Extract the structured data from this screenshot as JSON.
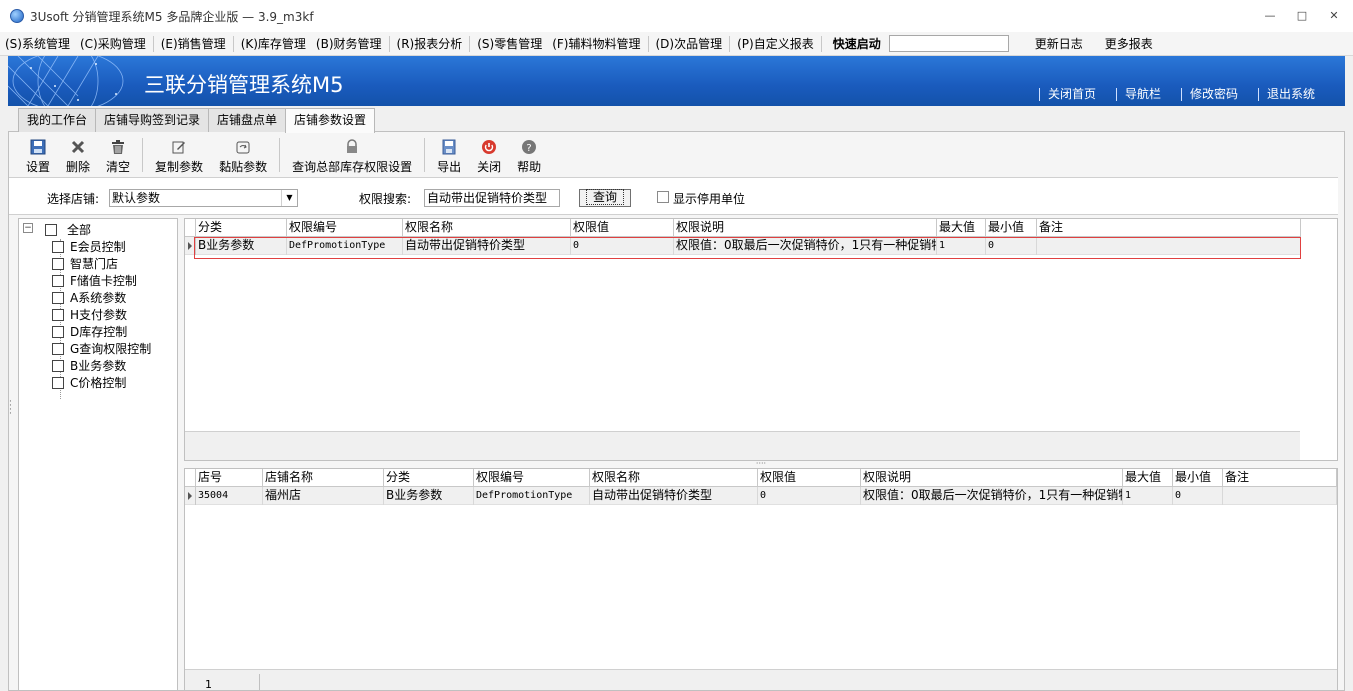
{
  "window": {
    "title": "3Usoft 分销管理系统M5 多品牌企业版 — 3.9_m3kf",
    "controls": [
      "minimize-icon",
      "restore-icon",
      "close-icon"
    ]
  },
  "menubar": {
    "items": [
      "(S)系统管理",
      "(C)采购管理",
      "(E)销售管理",
      "(K)库存管理",
      "(B)财务管理",
      "(R)报表分析",
      "(S)零售管理",
      "(F)辅料物料管理",
      "(D)次品管理",
      "(P)自定义报表"
    ],
    "quick_label": "快速启动",
    "quick_value": "",
    "right": [
      "更新日志",
      "更多报表"
    ]
  },
  "banner": {
    "brand": "三联分销管理系统M5",
    "links": [
      "关闭首页",
      "导航栏",
      "修改密码",
      "退出系统"
    ],
    "color": "#1a5bbd"
  },
  "tabs": [
    {
      "label": "我的工作台"
    },
    {
      "label": "店铺导购签到记录"
    },
    {
      "label": "店铺盘点单"
    },
    {
      "label": "店铺参数设置",
      "active": true
    }
  ],
  "toolbar": {
    "save": "设置",
    "delete": "删除",
    "clear": "清空",
    "copy": "复制参数",
    "paste": "黏贴参数",
    "query_perm": "查询总部库存权限设置",
    "export": "导出",
    "close": "关闭",
    "help": "帮助"
  },
  "filter": {
    "store_label": "选择店铺:",
    "store_value": "默认参数",
    "search_label": "权限搜索:",
    "search_value": "自动带出促销特价类型",
    "query_button": "查询",
    "show_disabled": "显示停用单位"
  },
  "tree": {
    "root": "全部",
    "items": [
      "E会员控制",
      "智慧门店",
      "F储值卡控制",
      "A系统参数",
      "H支付参数",
      "D库存控制",
      "G查询权限控制",
      "B业务参数",
      "C价格控制"
    ]
  },
  "grid1": {
    "headers": [
      "分类",
      "权限编号",
      "权限名称",
      "权限值",
      "权限说明",
      "最大值",
      "最小值",
      "备注"
    ],
    "rows": [
      [
        "B业务参数",
        "DefPromotionType",
        "自动带出促销特价类型",
        "0",
        "权限值：0取最后一次促销特价，1只有一种促销特",
        "1",
        "0",
        ""
      ]
    ]
  },
  "grid2": {
    "headers": [
      "店号",
      "店铺名称",
      "分类",
      "权限编号",
      "权限名称",
      "权限值",
      "权限说明",
      "最大值",
      "最小值",
      "备注"
    ],
    "rows": [
      [
        "35004",
        "福州店",
        "B业务参数",
        "DefPromotionType",
        "自动带出促销特价类型",
        "0",
        "权限值：0取最后一次促销特价，1只有一种促销特",
        "1",
        "0",
        ""
      ]
    ],
    "footer_count": "1"
  },
  "colors": {
    "accent_blue": "#1a5bbd",
    "highlight_red": "#e04040"
  }
}
